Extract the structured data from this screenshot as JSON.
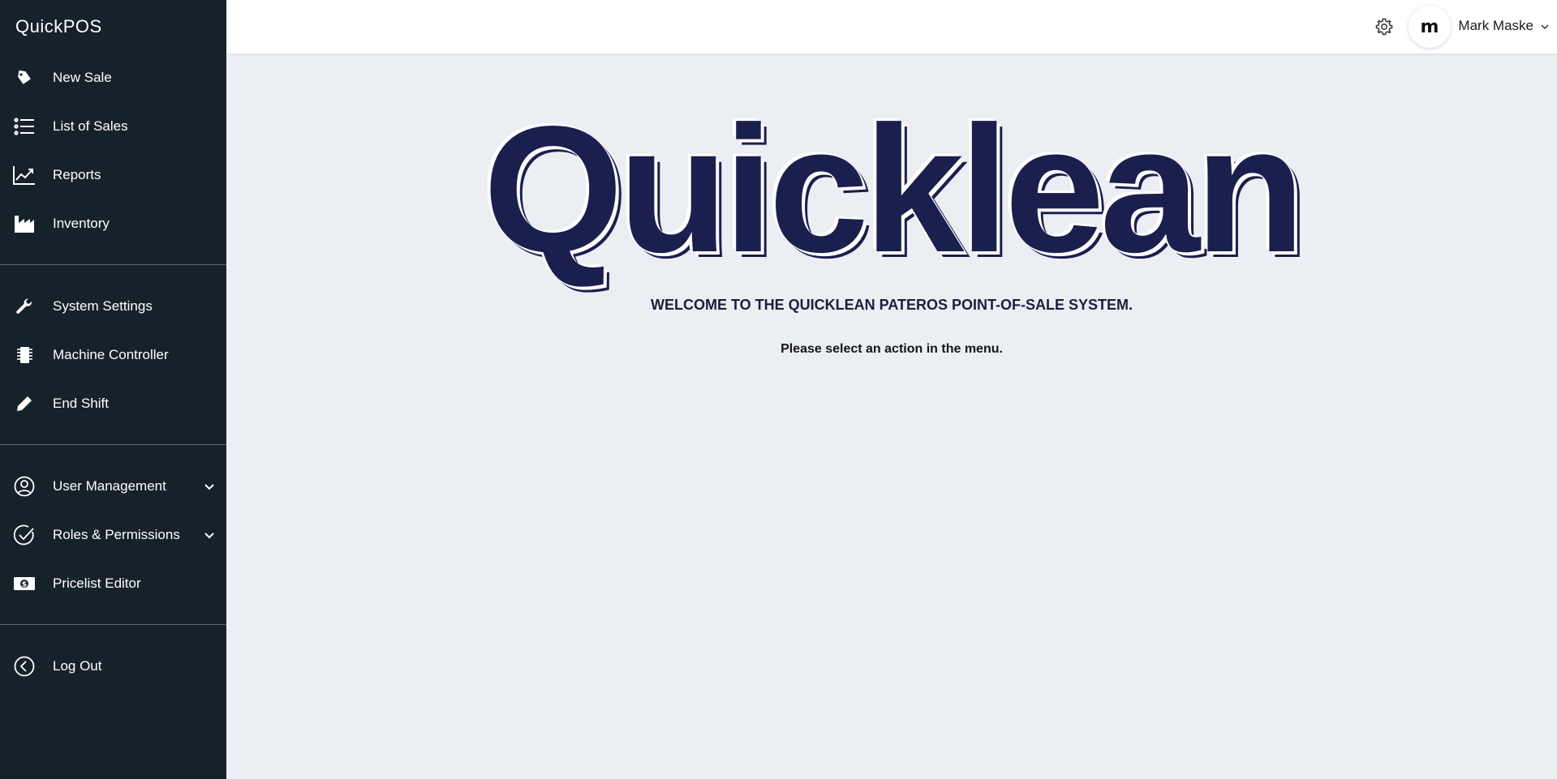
{
  "app": {
    "brand": "QuickPOS"
  },
  "sidebar": {
    "groups": [
      [
        {
          "label": "New Sale",
          "icon": "tag-icon"
        },
        {
          "label": "List of Sales",
          "icon": "list-icon"
        },
        {
          "label": "Reports",
          "icon": "chart-line-icon"
        },
        {
          "label": "Inventory",
          "icon": "factory-icon"
        }
      ],
      [
        {
          "label": "System Settings",
          "icon": "wrench-icon"
        },
        {
          "label": "Machine Controller",
          "icon": "chip-icon"
        },
        {
          "label": "End Shift",
          "icon": "pencil-icon"
        }
      ],
      [
        {
          "label": "User Management",
          "icon": "user-circle-icon",
          "expandable": true
        },
        {
          "label": "Roles & Permissions",
          "icon": "check-circle-icon",
          "expandable": true
        },
        {
          "label": "Pricelist Editor",
          "icon": "money-icon"
        }
      ],
      [
        {
          "label": "Log Out",
          "icon": "back-circle-icon"
        }
      ]
    ]
  },
  "topbar": {
    "user_initial": "m",
    "user_name": "Mark Maske"
  },
  "main": {
    "hero": "Quicklean",
    "welcome": "WELCOME TO THE QUICKLEAN PATEROS POINT-OF-SALE SYSTEM.",
    "instruction": "Please select an action in the menu."
  },
  "colors": {
    "sidebar_bg": "#16222a",
    "content_bg": "#ebeef3",
    "brand_navy": "#1b1f4d"
  }
}
